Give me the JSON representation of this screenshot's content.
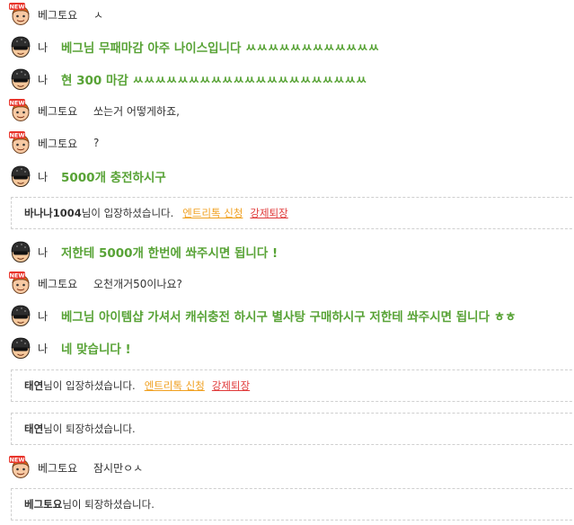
{
  "colors": {
    "my_message": "#58a336",
    "entry_link": "#f0a020",
    "kick_link": "#e03a3a",
    "notice_border": "#cfcfcf"
  },
  "messages": [
    {
      "type": "other",
      "avatar": "new-user-face-icon",
      "name": "베그토요",
      "text": "ㅅ"
    },
    {
      "type": "me",
      "avatar": "helmet-user-face-icon",
      "name": "나",
      "text": "베그님 무패마감 아주 나이스입니다 ㅆㅆㅆㅆㅆㅆㅆㅆㅆㅆㅆㅆ"
    },
    {
      "type": "me",
      "avatar": "helmet-user-face-icon",
      "name": "나",
      "text": "현 300 마감 ㅆㅆㅆㅆㅆㅆㅆㅆㅆㅆㅆㅆㅆㅆㅆㅆㅆㅆㅆㅆㅆ"
    },
    {
      "type": "other",
      "avatar": "new-user-face-icon",
      "name": "베그토요",
      "text": "쏘는거 어떻게하죠,"
    },
    {
      "type": "other",
      "avatar": "new-user-face-icon",
      "name": "베그토요",
      "text": "?"
    },
    {
      "type": "me",
      "avatar": "helmet-user-face-icon",
      "name": "나",
      "text": "5000개 충전하시구"
    },
    {
      "type": "notice",
      "nick": "바나나1004",
      "suffix": "님이 입장하셨습니다.",
      "entry_label": "엔트리톡 신청",
      "kick_label": "강제퇴장"
    },
    {
      "type": "me",
      "avatar": "helmet-user-face-icon",
      "name": "나",
      "text": "저한테 5000개 한번에 쏴주시면 됩니다 !"
    },
    {
      "type": "other",
      "avatar": "new-user-face-icon",
      "name": "베그토요",
      "text": "오천개거50이나요?"
    },
    {
      "type": "me",
      "avatar": "helmet-user-face-icon",
      "name": "나",
      "text": "베그님 아이템샵 가셔서 캐쉬충전 하시구 별사탕 구매하시구 저한테 쏴주시면 됩니다 ㅎㅎ"
    },
    {
      "type": "me",
      "avatar": "helmet-user-face-icon",
      "name": "나",
      "text": "네 맞습니다 !"
    },
    {
      "type": "notice",
      "nick": "태연",
      "suffix": "님이 입장하셨습니다.",
      "entry_label": "엔트리톡 신청",
      "kick_label": "강제퇴장"
    },
    {
      "type": "notice",
      "nick": "태연",
      "suffix": "님이 퇴장하셨습니다."
    },
    {
      "type": "other",
      "avatar": "new-user-face-icon",
      "name": "베그토요",
      "text": "잠시만ㅇㅅ"
    },
    {
      "type": "notice",
      "nick": "베그토요",
      "suffix": "님이 퇴장하셨습니다."
    }
  ]
}
